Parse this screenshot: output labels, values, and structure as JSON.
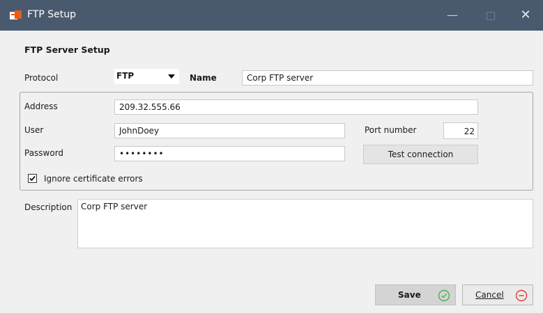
{
  "window": {
    "title": "FTP Setup",
    "minimize_glyph": "—",
    "close_glyph": "✕"
  },
  "section": {
    "title": "FTP Server Setup"
  },
  "form": {
    "protocol_label": "Protocol",
    "protocol_value": "FTP",
    "name_label": "Name",
    "name_value": "Corp FTP server",
    "address_label": "Address",
    "address_value": "209.32.555.66",
    "user_label": "User",
    "user_value": "JohnDoey",
    "port_label": "Port number",
    "port_value": "22",
    "password_label": "Password",
    "password_value": "••••••••",
    "test_button": "Test connection",
    "ignore_cert_label": "Ignore certificate errors",
    "ignore_cert_checked": true,
    "description_label": "Description",
    "description_value": "Corp FTP server"
  },
  "footer": {
    "save_label": "Save",
    "cancel_label": "Cancel"
  },
  "colors": {
    "titlebar": "#4a5a6e",
    "accent_check": "#4caf50",
    "cancel_icon": "#e53935",
    "app_icon": "#e85a1c"
  },
  "icons": {
    "app": "ftp-app-icon",
    "save": "checkmark-circle-icon",
    "cancel": "minus-circle-icon"
  }
}
